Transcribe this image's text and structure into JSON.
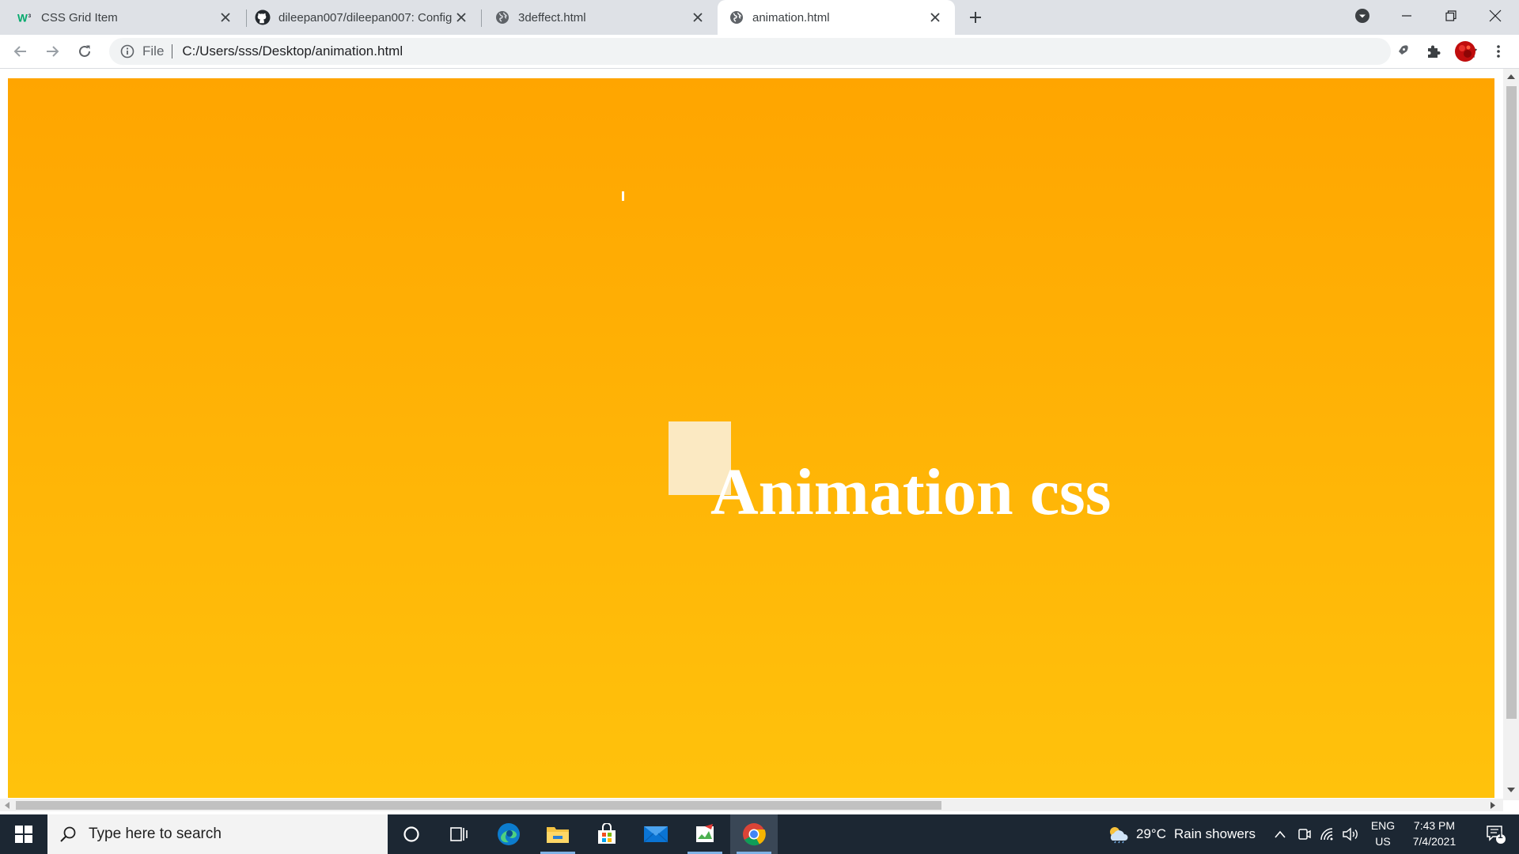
{
  "browser": {
    "tabs": [
      {
        "title": "CSS Grid Item",
        "favicon": "w3schools-icon",
        "active": false
      },
      {
        "title": "dileepan007/dileepan007: Config",
        "favicon": "github-icon",
        "active": false
      },
      {
        "title": "3deffect.html",
        "favicon": "globe-icon",
        "active": false
      },
      {
        "title": "animation.html",
        "favicon": "globe-icon",
        "active": true
      }
    ],
    "address": {
      "scheme_label": "File",
      "url": "C:/Users/sss/Desktop/animation.html"
    }
  },
  "page": {
    "heading": "Animation css",
    "background_top": "#ffa500",
    "background_bottom": "#ffc20c",
    "box_color": "#fbe9c2"
  },
  "taskbar": {
    "search_placeholder": "Type here to search",
    "weather": {
      "temperature": "29°C",
      "condition": "Rain showers"
    },
    "language": {
      "lang": "ENG",
      "region": "US"
    },
    "clock": {
      "time": "7:43 PM",
      "date": "7/4/2021"
    },
    "notifications_count": "1"
  }
}
